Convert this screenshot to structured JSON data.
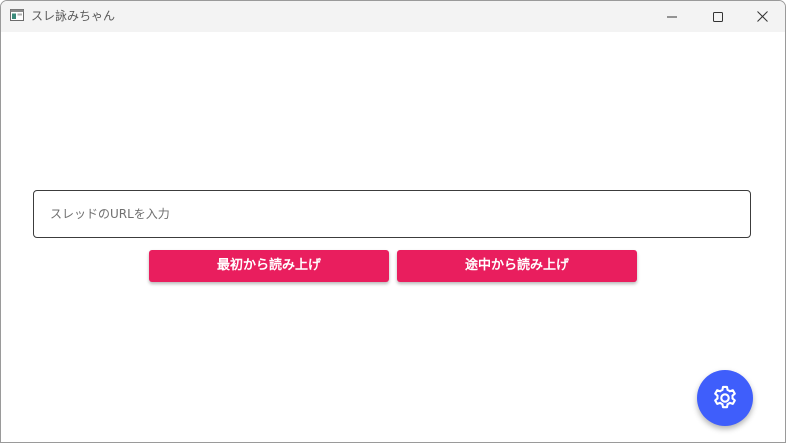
{
  "window": {
    "title": "スレ詠みちゃん",
    "controls": [
      "minimize",
      "maximize",
      "close"
    ]
  },
  "main": {
    "url_input": {
      "value": "",
      "placeholder": "スレッドのURLを入力"
    },
    "read_from_start_label": "最初から読み上げ",
    "read_from_middle_label": "途中から読み上げ"
  },
  "fab": {
    "icon": "gear-icon"
  },
  "colors": {
    "accent_button": "#e91e5e",
    "fab": "#3f5efb",
    "titlebar": "#f3f3f3"
  }
}
